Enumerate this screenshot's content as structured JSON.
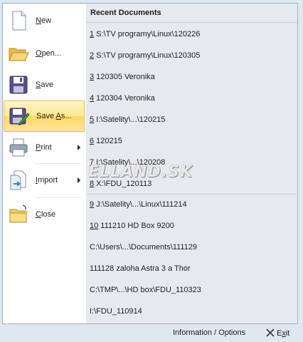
{
  "menu": {
    "items": [
      {
        "label": "New",
        "accel": "N",
        "rest": "ew",
        "icon": "new-document-icon"
      },
      {
        "label": "Open...",
        "accel": "O",
        "rest": "pen...",
        "icon": "open-folder-icon"
      },
      {
        "label": "Save",
        "accel": "S",
        "rest": "ave",
        "icon": "save-floppy-icon"
      },
      {
        "label": "Save As...",
        "accel": "A",
        "pre": "Save ",
        "rest": "s...",
        "icon": "save-as-icon"
      },
      {
        "label": "Print",
        "accel": "P",
        "rest": "rint",
        "icon": "printer-icon"
      },
      {
        "label": "Import",
        "accel": "I",
        "rest": "mport",
        "icon": "import-icon"
      },
      {
        "label": "Close",
        "accel": "C",
        "rest": "lose",
        "icon": "close-folder-icon"
      }
    ]
  },
  "recent": {
    "title": "Recent Documents",
    "items": [
      {
        "num": "1",
        "text": " S:\\TV programy\\Linux\\120226"
      },
      {
        "num": "2",
        "text": " S:\\TV programy\\Linux\\120305"
      },
      {
        "num": "3",
        "text": " 120305 Veronika"
      },
      {
        "num": "4",
        "text": " 120304 Veronika"
      },
      {
        "num": "5",
        "text": " I:\\Satelity\\...\\120215"
      },
      {
        "num": "6",
        "text": " 120215"
      },
      {
        "num": "7",
        "text": " I:\\Satelity\\...\\120208"
      },
      {
        "num": "8",
        "text": " X:\\FDU_120113"
      },
      {
        "num": "9",
        "text": " J:\\Satelity\\...\\Linux\\111214"
      },
      {
        "num": "10",
        "text": " 111210 HD Box 9200"
      },
      {
        "num": "",
        "text": "C:\\Users\\...\\Documents\\111129"
      },
      {
        "num": "",
        "text": "111128 zaloha Astra 3 a Thor"
      },
      {
        "num": "",
        "text": "C:\\TMP\\...\\HD box\\FDU_110323"
      },
      {
        "num": "",
        "text": "I:\\FDU_110914"
      }
    ]
  },
  "watermark": "ELLAND.SK",
  "footer": {
    "info_label": "Information / Options",
    "exit_accel": "x",
    "exit_pre": "E",
    "exit_rest": "it"
  }
}
